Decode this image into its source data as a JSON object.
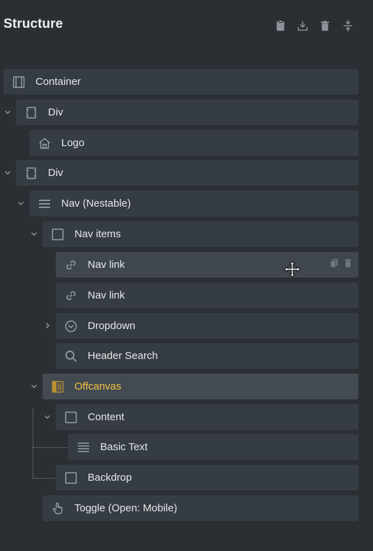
{
  "panel": {
    "title": "Structure",
    "toolbar": [
      {
        "name": "clipboard-icon"
      },
      {
        "name": "download-icon"
      },
      {
        "name": "trash-icon"
      },
      {
        "name": "collapse-expand-icon"
      }
    ]
  },
  "tree": [
    {
      "label": "Container",
      "icon": "container-icon",
      "expanded": null
    },
    {
      "label": "Div",
      "icon": "div-icon",
      "expanded": true
    },
    {
      "label": "Logo",
      "icon": "home-icon",
      "expanded": null
    },
    {
      "label": "Div",
      "icon": "div-icon",
      "expanded": true
    },
    {
      "label": "Nav (Nestable)",
      "icon": "menu-icon",
      "expanded": true
    },
    {
      "label": "Nav items",
      "icon": "block-icon",
      "expanded": true
    },
    {
      "label": "Nav link",
      "icon": "link-icon",
      "expanded": null,
      "state": "hover",
      "actions": [
        "copy-icon",
        "trash-icon"
      ]
    },
    {
      "label": "Nav link",
      "icon": "link-icon",
      "expanded": null
    },
    {
      "label": "Dropdown",
      "icon": "dropdown-icon",
      "expanded": false
    },
    {
      "label": "Header Search",
      "icon": "search-icon",
      "expanded": null
    },
    {
      "label": "Offcanvas",
      "icon": "offcanvas-icon",
      "expanded": true,
      "state": "active"
    },
    {
      "label": "Content",
      "icon": "block-icon",
      "expanded": true
    },
    {
      "label": "Basic Text",
      "icon": "text-icon",
      "expanded": null
    },
    {
      "label": "Backdrop",
      "icon": "block-icon",
      "expanded": null
    },
    {
      "label": "Toggle (Open: Mobile)",
      "icon": "hand-pointer-icon",
      "expanded": null
    }
  ],
  "colors": {
    "background": "#2b2f34",
    "row": "#363c43",
    "row_hover": "#3f464e",
    "active_text": "#f5c33f",
    "icon": "#9aa1a8"
  }
}
